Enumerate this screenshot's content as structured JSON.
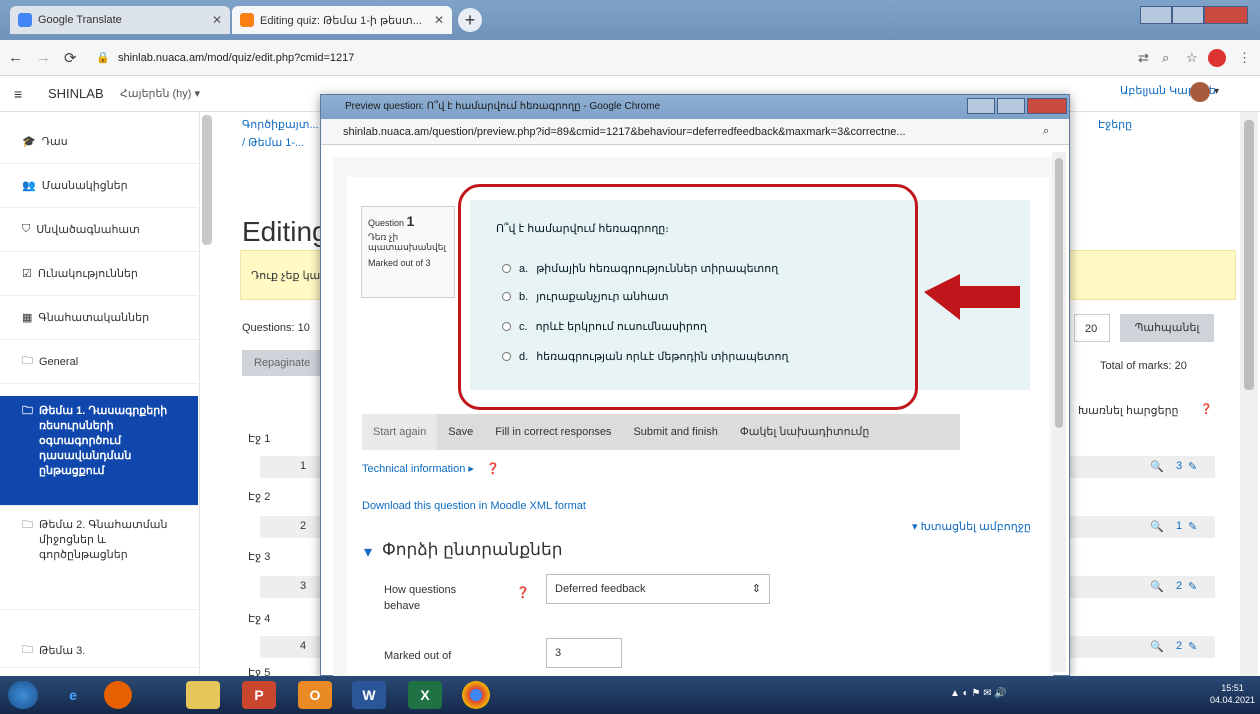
{
  "browser": {
    "tabs": [
      {
        "title": "Google Translate"
      },
      {
        "title": "Editing quiz: Թեմա 1-ի թեստ..."
      }
    ],
    "url": "shinlab.nuaca.am/mod/quiz/edit.php?cmid=1217"
  },
  "navbar": {
    "brand": "SHINLAB",
    "lang": "Հայերեն (hy) ▾",
    "user": "Աբելյան Կարինե"
  },
  "drawer": {
    "items": [
      "Դաս",
      "Մասնակիցներ",
      "Սնվածագնահատ",
      "Ունակություններ",
      "Գնահատականներ",
      "General",
      "Թեմա 1. Դասագրքերի ռեսուրսների օգտագործում դասավանդման ընթացքում",
      "Թեմա 2. Գնահատման միջոցներ և գործընթացներ",
      "Թեմա 3."
    ]
  },
  "main": {
    "breadcrumb_1": "Գործիքայտ...",
    "breadcrumb_2": "/ Թեմա 1-...",
    "breadcrumb_right": "Էջերը",
    "title": "Editing",
    "notice": "Դուք չեք կա...",
    "questions": "Questions: 10",
    "repaginate": "Repaginate",
    "max_grade": "20",
    "save": "Պահպանել",
    "total_marks": "Total of marks: 20",
    "shuffle": "Խառնել հարցերը",
    "pages": [
      {
        "label": "Էջ 1",
        "num": "1",
        "mark": "3"
      },
      {
        "label": "Էջ 2",
        "num": "2",
        "mark": "1"
      },
      {
        "label": "Էջ 3",
        "num": "3",
        "mark": "2"
      },
      {
        "label": "Էջ 4",
        "num": "4",
        "mark": "2"
      },
      {
        "label": "Էջ 5",
        "num": "",
        "mark": ""
      }
    ]
  },
  "popup": {
    "title": "Preview question: Ո՞վ է համարվում հեռագրողը - Google Chrome",
    "url": "shinlab.nuaca.am/question/preview.php?id=89&cmid=1217&behaviour=deferredfeedback&maxmark=3&correctne...",
    "question_label": "Question",
    "question_num": "1",
    "not_answered": "Դեռ չի պատասխանվել",
    "marked_out": "Marked out of 3",
    "question_text": "Ո՞վ է համարվում հեռագրողը։",
    "options": [
      {
        "letter": "a.",
        "text": "թիմային հեռագրություններ տիրապետող"
      },
      {
        "letter": "b.",
        "text": "յուրաքանչյուր անհատ"
      },
      {
        "letter": "c.",
        "text": "որևէ երկրում ուսումնասիրող"
      },
      {
        "letter": "d.",
        "text": "հեռագրության որևէ մեթոդին տիրապետող"
      }
    ],
    "buttons": [
      "Start again",
      "Save",
      "Fill in correct responses",
      "Submit and finish",
      "Փակել նախադիտումը"
    ],
    "tech_info": "Technical information ▸",
    "download": "Download this question in Moodle XML format",
    "expand_all": "▾ Խտացնել ամբողջը",
    "section": "Փորձի ընտրանքներ",
    "how_behave": "How questions behave",
    "behaviour_value": "Deferred feedback",
    "marked_out_label": "Marked out of",
    "marked_out_value": "3"
  },
  "taskbar": {
    "time": "15:51",
    "date": "04.04.2021"
  },
  "colors": {
    "accent": "#0f47ad",
    "highlight": "#c0161b",
    "question_bg": "#e7f3f5",
    "notice_bg": "#fff9c4"
  }
}
